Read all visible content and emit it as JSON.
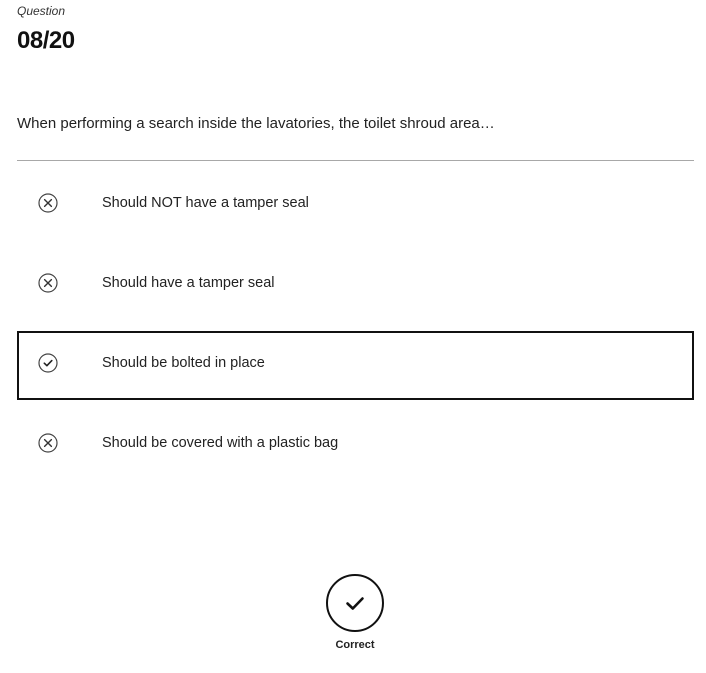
{
  "question": {
    "label": "Question",
    "number": "08/20",
    "text": "When performing a search inside the lavatories, the toilet shroud area…"
  },
  "options": [
    {
      "text": "Should NOT have a tamper seal",
      "icon": "x-circle-icon",
      "selected": false
    },
    {
      "text": "Should have a tamper seal",
      "icon": "x-circle-icon",
      "selected": false
    },
    {
      "text": "Should be bolted in place",
      "icon": "check-circle-icon",
      "selected": true
    },
    {
      "text": "Should be covered with a plastic bag",
      "icon": "x-circle-icon",
      "selected": false
    }
  ],
  "result": {
    "label": "Correct",
    "icon": "checkmark-icon"
  },
  "colors": {
    "text": "#222222",
    "divider": "#a8a8a8",
    "selected_border": "#111111"
  }
}
